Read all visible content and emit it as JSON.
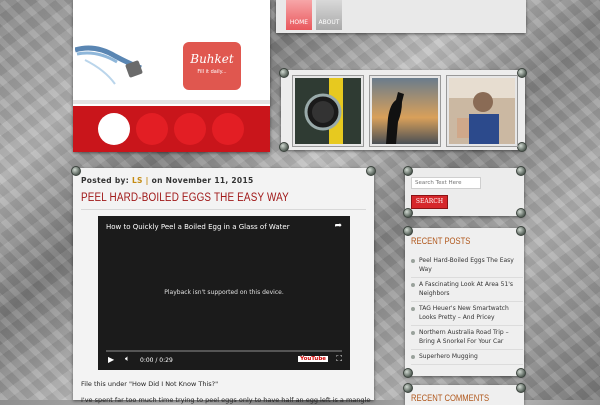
{
  "header": {
    "logo_name": "Buhket",
    "logo_tagline": "Fill it daily...",
    "slider_dots": 4,
    "active_dot": 0
  },
  "nav": {
    "items": [
      {
        "label": "HOME",
        "active": true
      },
      {
        "label": "ABOUT",
        "active": false
      }
    ]
  },
  "gallery": {
    "thumbnails": [
      "wristwatch photo",
      "silhouette with binoculars at sunset",
      "person snorkeling photo"
    ]
  },
  "post": {
    "meta_prefix": "Posted by:",
    "author": "LS",
    "separator": "|",
    "date_text": "on November 11, 2015",
    "title": "Peel Hard-Boiled Eggs The Easy Way",
    "video": {
      "title": "How to Quickly Peel a Boiled Egg in a Glass of Water",
      "message": "Playback isn't supported on this device.",
      "time": "0:00 / 0:29",
      "brand": "YouTube"
    },
    "paragraph_1": "File this under \"How Did I Not Know This?\"",
    "paragraph_2": "I've spent far too much time trying to peel eggs only to have half an egg left is a mangled"
  },
  "sidebar": {
    "search": {
      "placeholder": "Search Text Here",
      "button_label": "SEARCH"
    },
    "recent_posts": {
      "title": "Recent Posts",
      "items": [
        "Peel Hard-Boiled Eggs The Easy Way",
        "A Fascinating Look At Area 51's Neighbors",
        "TAG Heuer's New Smartwatch Looks Pretty – And Pricey",
        "Northern Australia Road Trip – Bring A Snorkel For Your Car",
        "Superhero Mugging"
      ]
    },
    "recent_comments": {
      "title": "Recent Comments"
    }
  },
  "colors": {
    "accent_red": "#c9151b",
    "title_red": "#a01818",
    "widget_title": "#b0571b",
    "author_gold": "#c48b12"
  }
}
